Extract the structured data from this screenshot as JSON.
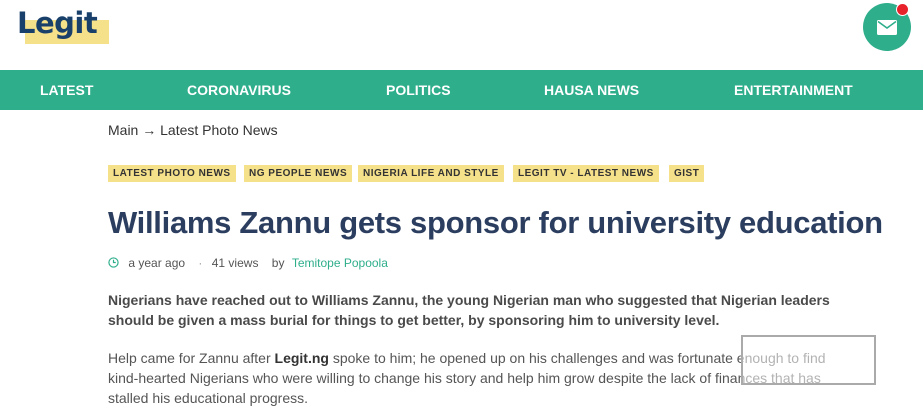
{
  "header": {
    "logo_text": "Legit",
    "mail_icon": "envelope-icon",
    "colors": {
      "brand": "#2fae8c",
      "logo_text": "#19406b",
      "highlight": "#f6e18b",
      "notification": "#e8222b"
    }
  },
  "nav": {
    "items": [
      {
        "label": "LATEST"
      },
      {
        "label": "CORONAVIRUS"
      },
      {
        "label": "POLITICS"
      },
      {
        "label": "HAUSA NEWS"
      },
      {
        "label": "ENTERTAINMENT"
      }
    ]
  },
  "breadcrumb": {
    "root": "Main",
    "separator": "→",
    "current": "Latest Photo News"
  },
  "tags": [
    {
      "label": "LATEST PHOTO NEWS"
    },
    {
      "label": "NG PEOPLE NEWS"
    },
    {
      "label": "NIGERIA LIFE AND STYLE"
    },
    {
      "label": "LEGIT TV - LATEST NEWS"
    },
    {
      "label": "GIST"
    }
  ],
  "article": {
    "title": "Williams Zannu gets sponsor for university education",
    "meta": {
      "time_icon": "clock-icon",
      "time": "a year ago",
      "views": "41 views",
      "by": "by",
      "author": "Temitope Popoola"
    },
    "lead": "Nigerians have reached out to Williams Zannu, the young Nigerian man who suggested that Nigerian leaders should be given a mass burial for things to get better, by sponsoring him to university level.",
    "body_before": "Help came for Zannu after ",
    "body_link": "Legit.ng",
    "body_after": " spoke to him; he opened up on his challenges and was fortunate enough to find kind-hearted Nigerians who were willing to change his story and help him grow despite the lack of finances that has stalled his educational progress."
  }
}
